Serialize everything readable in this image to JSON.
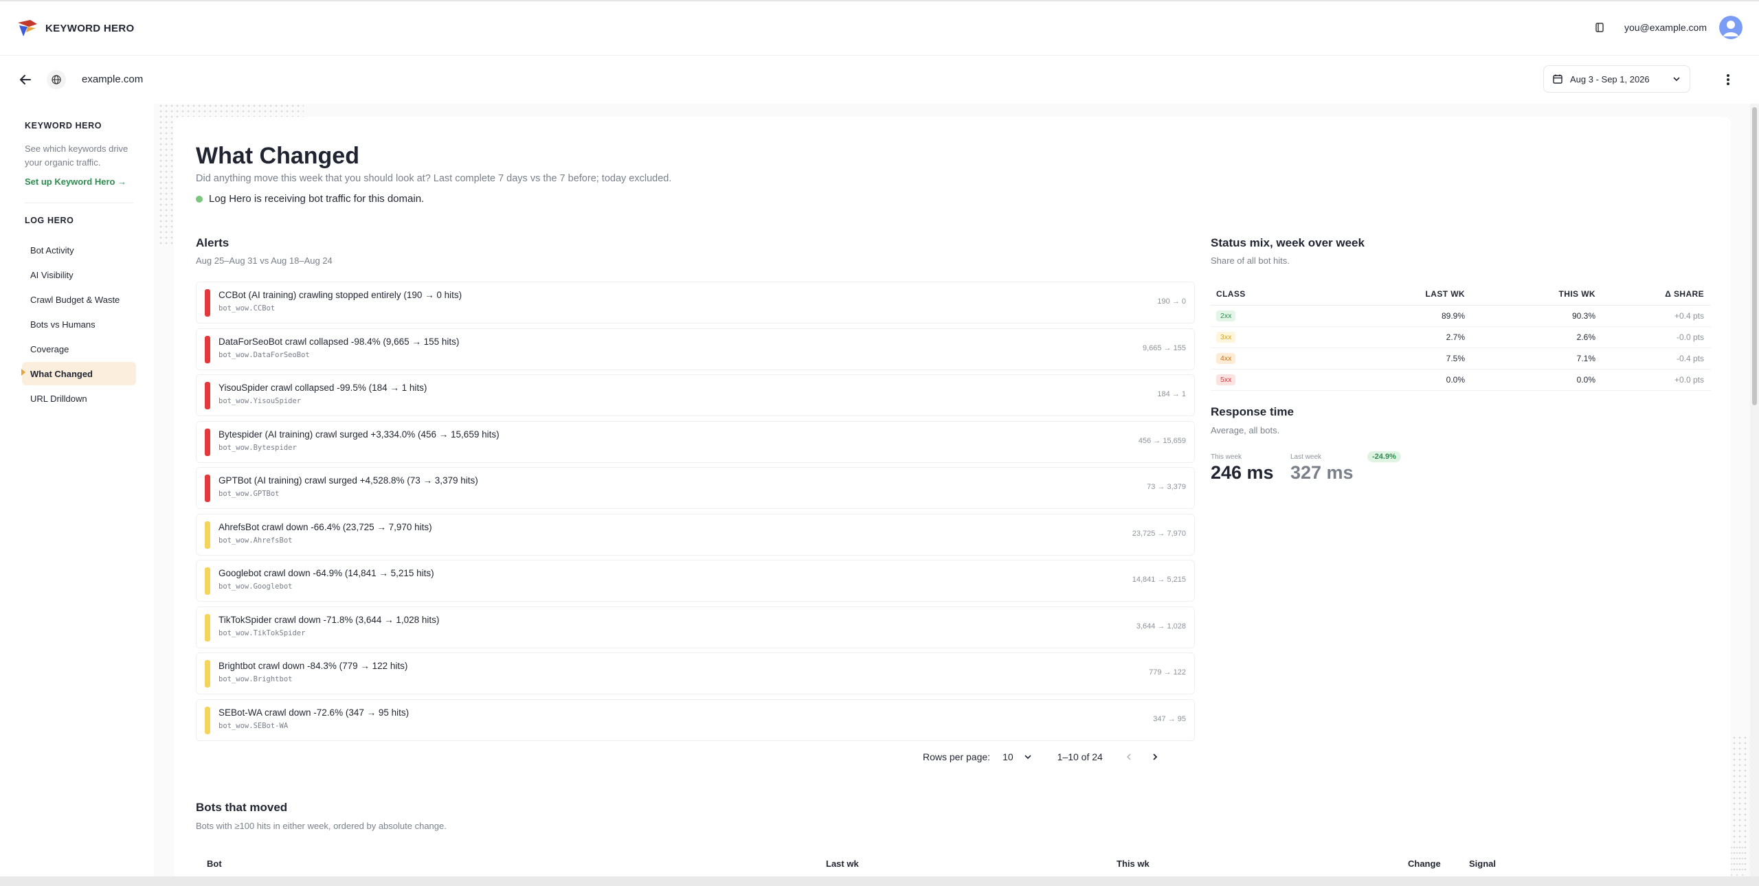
{
  "app": {
    "brand_name": "KEYWORD HERO",
    "user_email": "you@example.com"
  },
  "domain_bar": {
    "domain": "example.com",
    "date_range": "Aug 3 - Sep 1, 2026"
  },
  "sidebar": {
    "keyword_hero": {
      "heading": "KEYWORD HERO",
      "description": "See which keywords drive your organic traffic.",
      "link": "Set up Keyword Hero →"
    },
    "log_hero": {
      "heading": "LOG HERO",
      "items": [
        {
          "label": "Bot Activity",
          "active": false
        },
        {
          "label": "AI Visibility",
          "active": false
        },
        {
          "label": "Crawl Budget & Waste",
          "active": false
        },
        {
          "label": "Bots vs Humans",
          "active": false
        },
        {
          "label": "Coverage",
          "active": false
        },
        {
          "label": "What Changed",
          "active": true
        },
        {
          "label": "URL Drilldown",
          "active": false
        }
      ]
    }
  },
  "page": {
    "title": "What Changed",
    "subtitle": "Did anything move this week that you should look at? Last complete 7 days vs the 7 before; today excluded.",
    "status_text": "Log Hero is receiving bot traffic for this domain."
  },
  "alerts": {
    "title": "Alerts",
    "subtitle": "Aug 25–Aug 31 vs Aug 18–Aug 24",
    "items": [
      {
        "severity": "red",
        "text": "CCBot (AI training) crawling stopped entirely (190 → 0 hits)",
        "code": "bot_wow.CCBot",
        "delta": "190 → 0"
      },
      {
        "severity": "red",
        "text": "DataForSeoBot crawl collapsed -98.4% (9,665 → 155 hits)",
        "code": "bot_wow.DataForSeoBot",
        "delta": "9,665 → 155"
      },
      {
        "severity": "red",
        "text": "YisouSpider crawl collapsed -99.5% (184 → 1 hits)",
        "code": "bot_wow.YisouSpider",
        "delta": "184 → 1"
      },
      {
        "severity": "red",
        "text": "Bytespider (AI training) crawl surged +3,334.0% (456 → 15,659 hits)",
        "code": "bot_wow.Bytespider",
        "delta": "456 → 15,659"
      },
      {
        "severity": "red",
        "text": "GPTBot (AI training) crawl surged +4,528.8% (73 → 3,379 hits)",
        "code": "bot_wow.GPTBot",
        "delta": "73 → 3,379"
      },
      {
        "severity": "yellow",
        "text": "AhrefsBot crawl down -66.4% (23,725 → 7,970 hits)",
        "code": "bot_wow.AhrefsBot",
        "delta": "23,725 → 7,970"
      },
      {
        "severity": "yellow",
        "text": "Googlebot crawl down -64.9% (14,841 → 5,215 hits)",
        "code": "bot_wow.Googlebot",
        "delta": "14,841 → 5,215"
      },
      {
        "severity": "yellow",
        "text": "TikTokSpider crawl down -71.8% (3,644 → 1,028 hits)",
        "code": "bot_wow.TikTokSpider",
        "delta": "3,644 → 1,028"
      },
      {
        "severity": "yellow",
        "text": "Brightbot crawl down -84.3% (779 → 122 hits)",
        "code": "bot_wow.Brightbot",
        "delta": "779 → 122"
      },
      {
        "severity": "yellow",
        "text": "SEBot-WA crawl down -72.6% (347 → 95 hits)",
        "code": "bot_wow.SEBot-WA",
        "delta": "347 → 95"
      }
    ],
    "pagination": {
      "rows_label": "Rows per page:",
      "rows_value": "10",
      "range": "1–10 of 24"
    }
  },
  "status_mix": {
    "title": "Status mix, week over week",
    "subtitle": "Share of all bot hits.",
    "headers": [
      "CLASS",
      "LAST WK",
      "THIS WK",
      "Δ SHARE"
    ],
    "rows": [
      {
        "class": "2xx",
        "last": "89.9%",
        "this": "90.3%",
        "delta": "+0.4 pts",
        "fg": "#2c8b4f",
        "bg": "#e3f5e6"
      },
      {
        "class": "3xx",
        "last": "2.7%",
        "this": "2.6%",
        "delta": "-0.0 pts",
        "fg": "#d6a521",
        "bg": "#fdf6dc"
      },
      {
        "class": "4xx",
        "last": "7.5%",
        "this": "7.1%",
        "delta": "-0.4 pts",
        "fg": "#c7761b",
        "bg": "#fdebd6"
      },
      {
        "class": "5xx",
        "last": "0.0%",
        "this": "0.0%",
        "delta": "+0.0 pts",
        "fg": "#d33a3d",
        "bg": "#fde2e2"
      }
    ]
  },
  "response_time": {
    "title": "Response time",
    "subtitle": "Average, all bots.",
    "this_week_label": "This week",
    "this_week_value": "246 ms",
    "last_week_label": "Last week",
    "last_week_value": "327 ms",
    "change": "-24.9%"
  },
  "bots_moved": {
    "title": "Bots that moved",
    "subtitle": "Bots with ≥100 hits in either week, ordered by absolute change.",
    "headers": {
      "bot": "Bot",
      "last": "Last wk",
      "this": "This wk",
      "change": "Change",
      "signal": "Signal"
    }
  }
}
